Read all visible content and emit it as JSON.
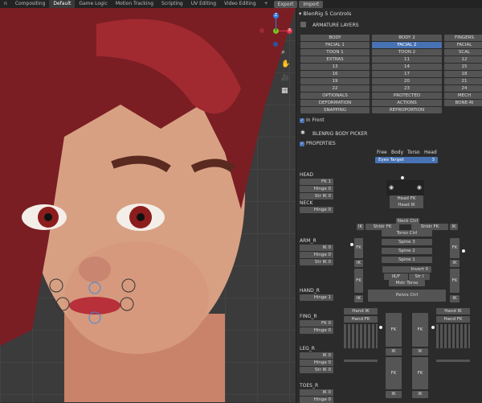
{
  "topbar": {
    "tabs": [
      "n",
      "Compositing",
      "Default",
      "Game Logic",
      "Motion Tracking",
      "Scripting",
      "UV Editing",
      "Video Editing"
    ],
    "active_tab": "Default",
    "add": "+",
    "export": "Export",
    "import": "Import"
  },
  "gizmo": {
    "z": "Z",
    "y": "Y",
    "x": "X"
  },
  "panel": {
    "title": "BlenRig 5 Controls",
    "armature_layers": "ARMATURE LAYERS",
    "layers": [
      [
        "BODY",
        "BODY 2",
        "FINGERS"
      ],
      [
        "FACIAL 1",
        "FACIAL 2",
        "FACIAL"
      ],
      [
        "TOON 1",
        "TOON 2",
        "SCAL"
      ],
      [
        "EXTRAS",
        "11",
        "12"
      ],
      [
        "13",
        "14",
        "15"
      ],
      [
        "16",
        "17",
        "18"
      ],
      [
        "19",
        "20",
        "21"
      ],
      [
        "22",
        "23",
        "24"
      ],
      [
        "OPTIONALS",
        "PROTECTED",
        "MECH"
      ],
      [
        "DEFORMATION",
        "ACTIONS",
        "BONE-RI"
      ],
      [
        "SNAPPING",
        "REPROPORTION",
        ""
      ]
    ],
    "selected_layer": "FACIAL 2",
    "in_front": "In Front",
    "body_picker": "BLENRIG BODY PICKER",
    "properties": "PROPERTIES",
    "target_tabs": [
      "Free",
      "Body",
      "Torso",
      "Head"
    ],
    "eyes_target": {
      "label": "Eyes Target",
      "value": "3"
    }
  },
  "props": {
    "head": {
      "title": "HEAD",
      "items": [
        "FK 1",
        "Hinge 0",
        "Str IK 0"
      ]
    },
    "neck": {
      "title": "NECK",
      "items": [
        "Hinge 0"
      ]
    },
    "arm_r": {
      "title": "ARM_R",
      "items": [
        "IK 0",
        "Hinge 0",
        "Str IK 0"
      ]
    },
    "hand_r": {
      "title": "HAND_R",
      "items": [
        "Hinge 1"
      ]
    },
    "fing_r": {
      "title": "FING_R",
      "items": [
        "FK 0",
        "Hinge 0"
      ]
    },
    "leg_r": {
      "title": "LEG_R",
      "items": [
        "IK 0",
        "Hinge 0",
        "Str IK 0"
      ]
    },
    "toes_r": {
      "title": "TOES_R",
      "items": [
        "IK 0",
        "Hinge 0"
      ]
    }
  },
  "picker": {
    "head_fk": "Head FK",
    "head_ik": "Head IK",
    "neck_ctrl": "Neck Ctrl",
    "ik": "IK",
    "fk": "FK",
    "shldr_fk": "Shldr FK",
    "torso_ctrl": "Torso Ctrl",
    "spine3": "Spine 3",
    "spine2": "Spine 2",
    "spine1": "Spine 1",
    "invert": "Invert 0",
    "ikf": "IK/F",
    "stri": "Str I",
    "mstr_torso": "Mstr Torso",
    "pelvis_ctrl": "Pelvis Ctrl",
    "hand_ik": "Hand IK",
    "hand_fk": "Hand FK"
  }
}
